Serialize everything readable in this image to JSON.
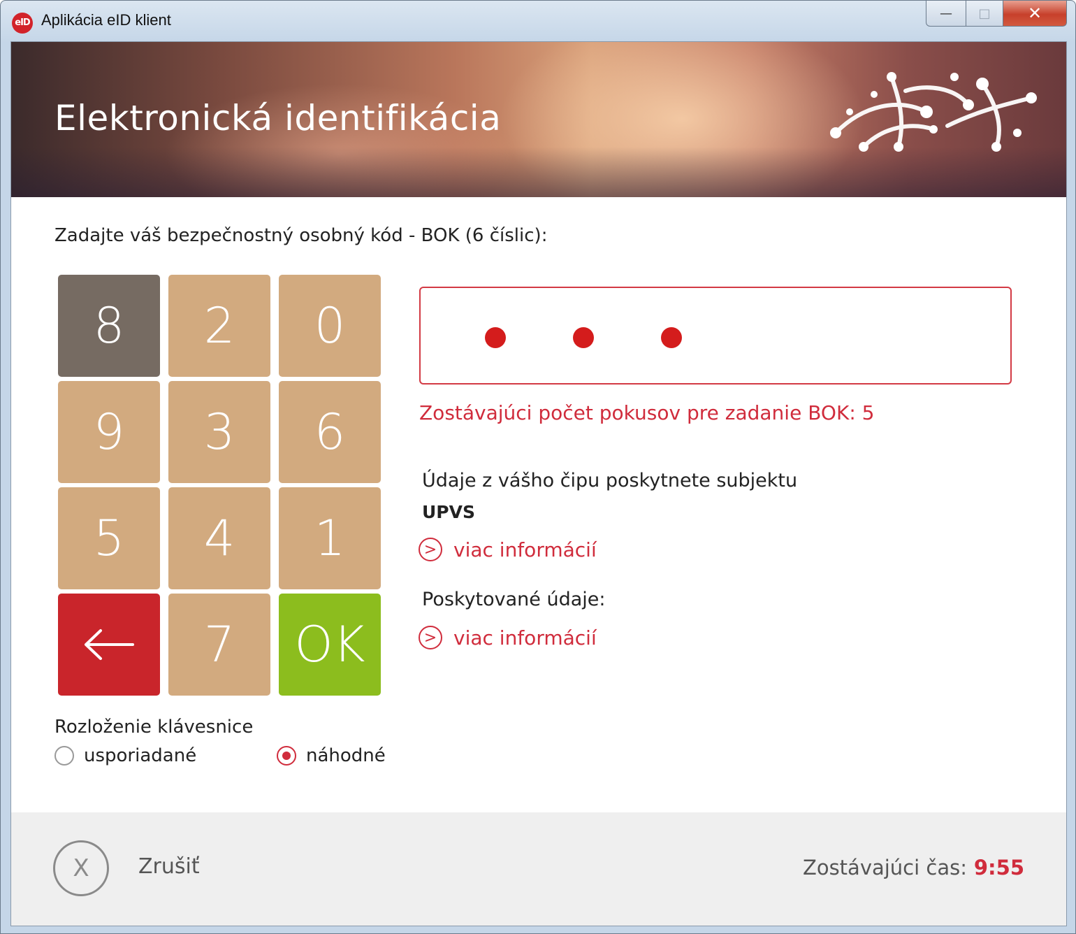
{
  "window": {
    "title": "Aplikácia eID klient",
    "app_icon_text": "eID",
    "controls": {
      "minimize": "—",
      "maximize": "□",
      "close": "✕"
    }
  },
  "banner": {
    "title": "Elektronická identifikácia"
  },
  "prompt": "Zadajte váš bezpečnostný osobný kód - BOK (6 číslic):",
  "keypad": {
    "keys": [
      "8",
      "2",
      "0",
      "9",
      "3",
      "6",
      "5",
      "4",
      "1",
      "←",
      "7",
      "OK"
    ],
    "active_key": "8"
  },
  "pin": {
    "entered_digits": 3,
    "length": 6
  },
  "attempts_text": "Zostávajúci počet pokusov pre zadanie BOK: 5",
  "data_info": {
    "label": "Údaje z vášho čipu poskytnete subjektu",
    "subject": "UPVS",
    "more_link": "viac informácií",
    "link_icon": "chevron-right-icon"
  },
  "provided": {
    "label": "Poskytované údaje:",
    "more_link": "viac informácií",
    "link_icon": "chevron-right-icon"
  },
  "keyboard_layout": {
    "label": "Rozloženie klávesnice",
    "options": [
      "usporiadané",
      "náhodné"
    ],
    "selected": "náhodné"
  },
  "footer": {
    "cancel_label": "Zrušiť",
    "cancel_icon": "X",
    "time_label": "Zostávajúci čas:",
    "time_value": "9:55"
  },
  "colors": {
    "accent_red": "#d02c3c",
    "key_tan": "#d2aa7f",
    "key_active": "#766b62",
    "key_back": "#c9252b",
    "key_ok": "#8cbd1e"
  }
}
